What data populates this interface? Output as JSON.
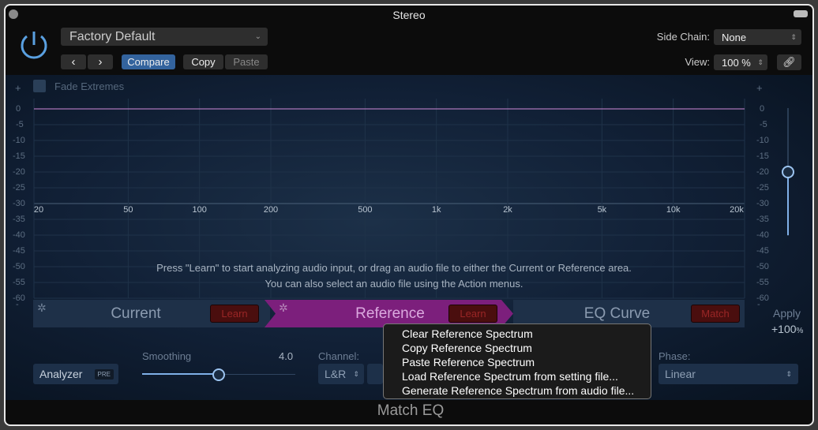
{
  "window": {
    "title": "Stereo",
    "plugin_name": "Match EQ"
  },
  "header": {
    "preset": "Factory Default",
    "compare": "Compare",
    "copy": "Copy",
    "paste": "Paste",
    "side_chain_label": "Side Chain:",
    "side_chain_value": "None",
    "view_label": "View:",
    "view_value": "100 %"
  },
  "graph": {
    "fade_extremes": "Fade Extremes",
    "db_ticks": [
      "0",
      "-5",
      "-10",
      "-15",
      "-20",
      "-25",
      "-30",
      "-35",
      "-40",
      "-45",
      "-50",
      "-55",
      "-60"
    ],
    "freq_ticks": [
      [
        "20",
        20
      ],
      [
        "50",
        50
      ],
      [
        "100",
        100
      ],
      [
        "200",
        200
      ],
      [
        "500",
        500
      ],
      [
        "1k",
        1000
      ],
      [
        "2k",
        2000
      ],
      [
        "5k",
        5000
      ],
      [
        "10k",
        10000
      ],
      [
        "20k",
        20000
      ]
    ],
    "hint_line1": "Press \"Learn\" to start analyzing audio input, or drag an audio file to either the Current or Reference area.",
    "hint_line2": "You can also select an audio file using the Action menus.",
    "plus": "+",
    "minus": "-",
    "curve_color": "#d08ad8"
  },
  "bands": {
    "current": "Current",
    "current_learn": "Learn",
    "reference": "Reference",
    "reference_learn": "Learn",
    "eq_curve": "EQ Curve",
    "match": "Match",
    "reference_color": "#7c1f7c"
  },
  "apply": {
    "label": "Apply",
    "value": "+100",
    "unit": "%",
    "level_db": -20
  },
  "controls": {
    "analyzer": "Analyzer",
    "analyzer_badge": "PRE",
    "smoothing_label": "Smoothing",
    "smoothing_value": "4.0",
    "smoothing_fraction": 0.5,
    "channel_label": "Channel:",
    "channel_value": "L&R",
    "phase_label": "Phase:",
    "phase_value": "Linear"
  },
  "context_menu": [
    "Clear Reference Spectrum",
    "Copy Reference Spectrum",
    "Paste Reference Spectrum",
    "Load Reference Spectrum from setting file...",
    "Generate Reference Spectrum from audio file..."
  ]
}
